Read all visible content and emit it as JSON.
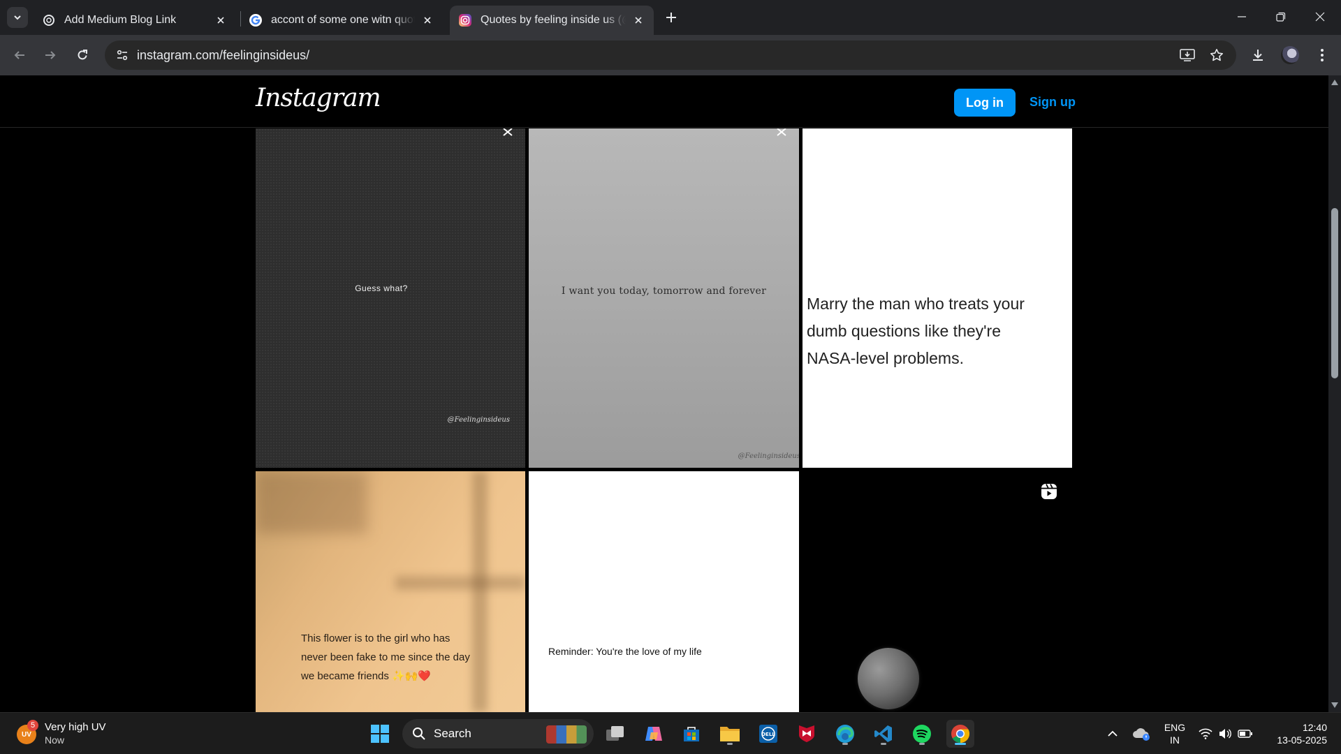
{
  "browser": {
    "tabs": [
      {
        "title": "Add Medium Blog Link",
        "active": false,
        "favicon": "openai-icon"
      },
      {
        "title": "accont of some one witn quotes",
        "active": false,
        "favicon": "google-icon"
      },
      {
        "title": "Quotes by feeling inside us (@feelinginsideus)",
        "active": true,
        "favicon": "instagram-icon"
      }
    ],
    "url": "instagram.com/feelinginsideus/"
  },
  "instagram": {
    "logo": "Instagram",
    "login_label": "Log in",
    "signup_label": "Sign up",
    "posts": [
      {
        "text": "Guess what?",
        "watermark": "@Feelinginsideus"
      },
      {
        "text": "I want you today, tomorrow and forever",
        "watermark": "@Feelinginsideus"
      },
      {
        "text": "Marry the man who treats your dumb questions like they're NASA-level problems."
      },
      {
        "text": "This flower is to the girl who has never been fake to me since the day we became friends ✨🙌❤️"
      },
      {
        "text": "Reminder: You're the love of my life"
      },
      {
        "type": "reel",
        "icon": "reel-icon"
      }
    ]
  },
  "taskbar": {
    "weather_title": "Very high UV",
    "weather_sub": "Now",
    "weather_badge": "5",
    "weather_avatar": "UV",
    "search_label": "Search",
    "lang_top": "ENG",
    "lang_bottom": "IN",
    "time": "12:40",
    "date": "13-05-2025"
  },
  "colors": {
    "instagram_blue": "#0095f6",
    "chrome_frame": "#202124",
    "chrome_toolbar": "#35363a"
  }
}
